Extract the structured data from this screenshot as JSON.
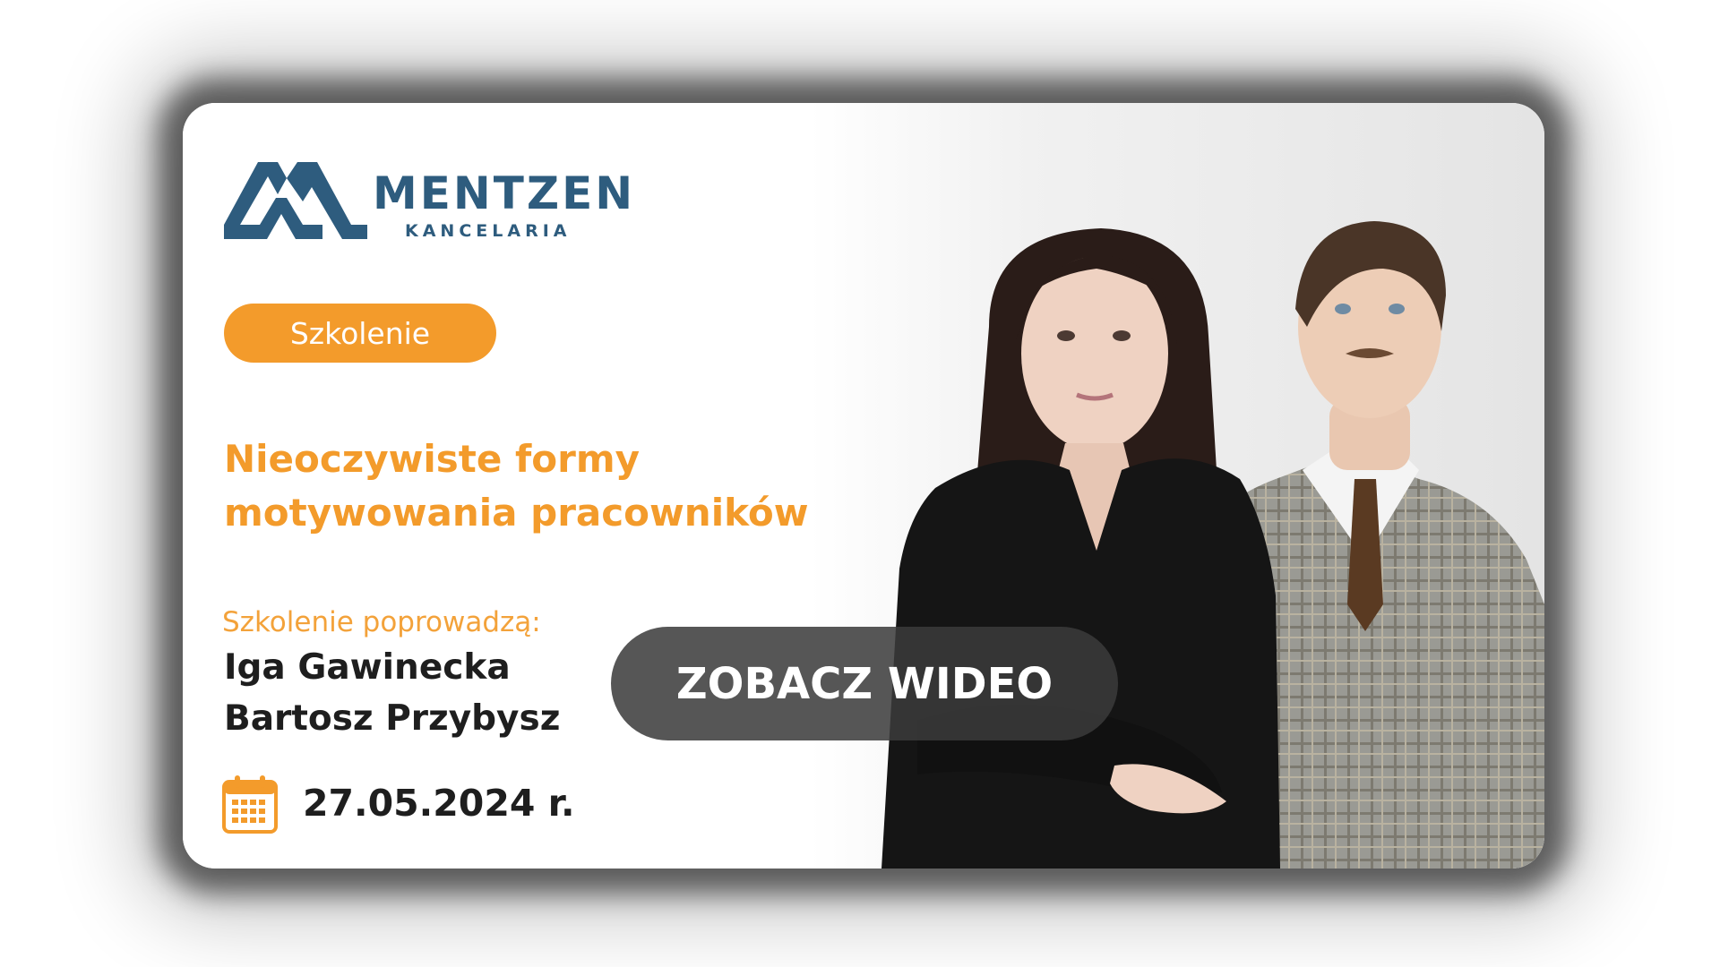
{
  "logo": {
    "name": "MENTZEN",
    "subtitle": "KANCELARIA"
  },
  "badge": {
    "label": "Szkolenie"
  },
  "title": {
    "line1": "Nieoczywiste formy",
    "line2": "motywowania pracowników"
  },
  "hosts": {
    "label": "Szkolenie poprowadzą:",
    "names": [
      "Iga Gawinecka",
      "Bartosz Przybysz"
    ]
  },
  "event": {
    "date": "27.05.2024 r.",
    "icon": "calendar-icon"
  },
  "cta": {
    "label": "ZOBACZ WIDEO"
  },
  "colors": {
    "brand_blue": "#2e5c7e",
    "accent_orange": "#f39b2b",
    "text_dark": "#1e1e1e",
    "cta_background": "#3a3a3a"
  }
}
